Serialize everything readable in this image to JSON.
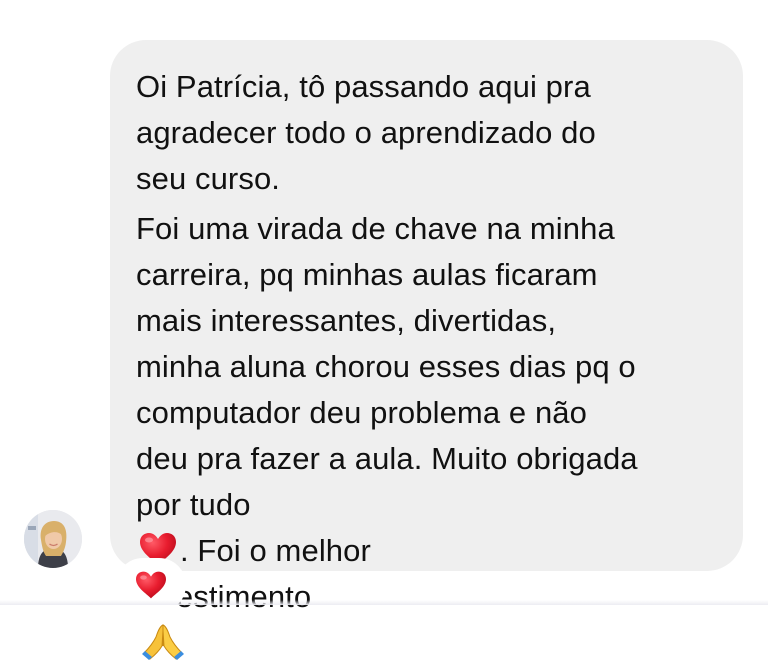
{
  "message": {
    "paragraph1": "Oi Patrícia, tô passando aqui pra\nagradecer todo o aprendizado do\nseu curso.",
    "paragraph2_before_heart": "Foi uma virada de chave na minha\ncarreira, pq minhas aulas ficaram\nmais interessantes, divertidas,\nminha aluna chorou esses dias pq o\ncomputador deu problema e não\ndeu pra fazer a aula. Muito obrigada\npor tudo",
    "paragraph2_after_heart": ". Foi o melhor\ninvestimento",
    "heart_emoji": "red-heart",
    "end_emoji": "folded-hands"
  },
  "reaction": {
    "emoji": "red-heart"
  },
  "colors": {
    "bubble": "#efefef",
    "text": "#111111",
    "heart": "#e0142a",
    "hands": "#f5b825"
  }
}
